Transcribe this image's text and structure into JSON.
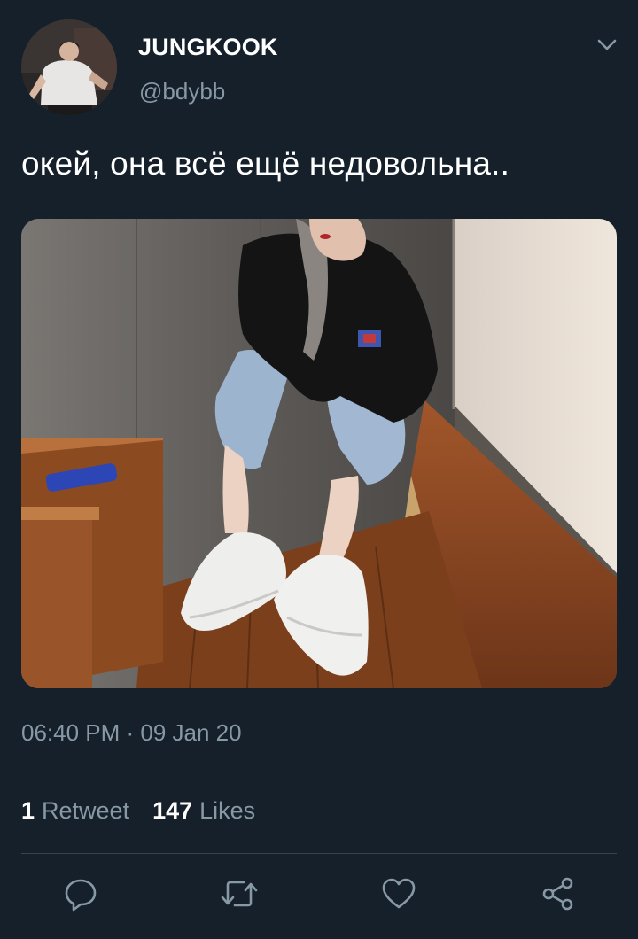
{
  "author": {
    "display_name": "JUNGKOOK",
    "handle": "@bdybb"
  },
  "tweet": {
    "text": "окей, она всё ещё недовольна..",
    "timestamp": "06:40 PM · 09 Jan 20"
  },
  "stats": {
    "retweets_count": "1",
    "retweets_label": "Retweet",
    "likes_count": "147",
    "likes_label": "Likes"
  },
  "icons": {
    "caret": "chevron-down-icon",
    "reply": "reply-icon",
    "retweet": "retweet-icon",
    "like": "heart-icon",
    "share": "share-icon"
  },
  "colors": {
    "background": "#15202b",
    "secondary_text": "#8899a6",
    "divider": "#38444d"
  }
}
